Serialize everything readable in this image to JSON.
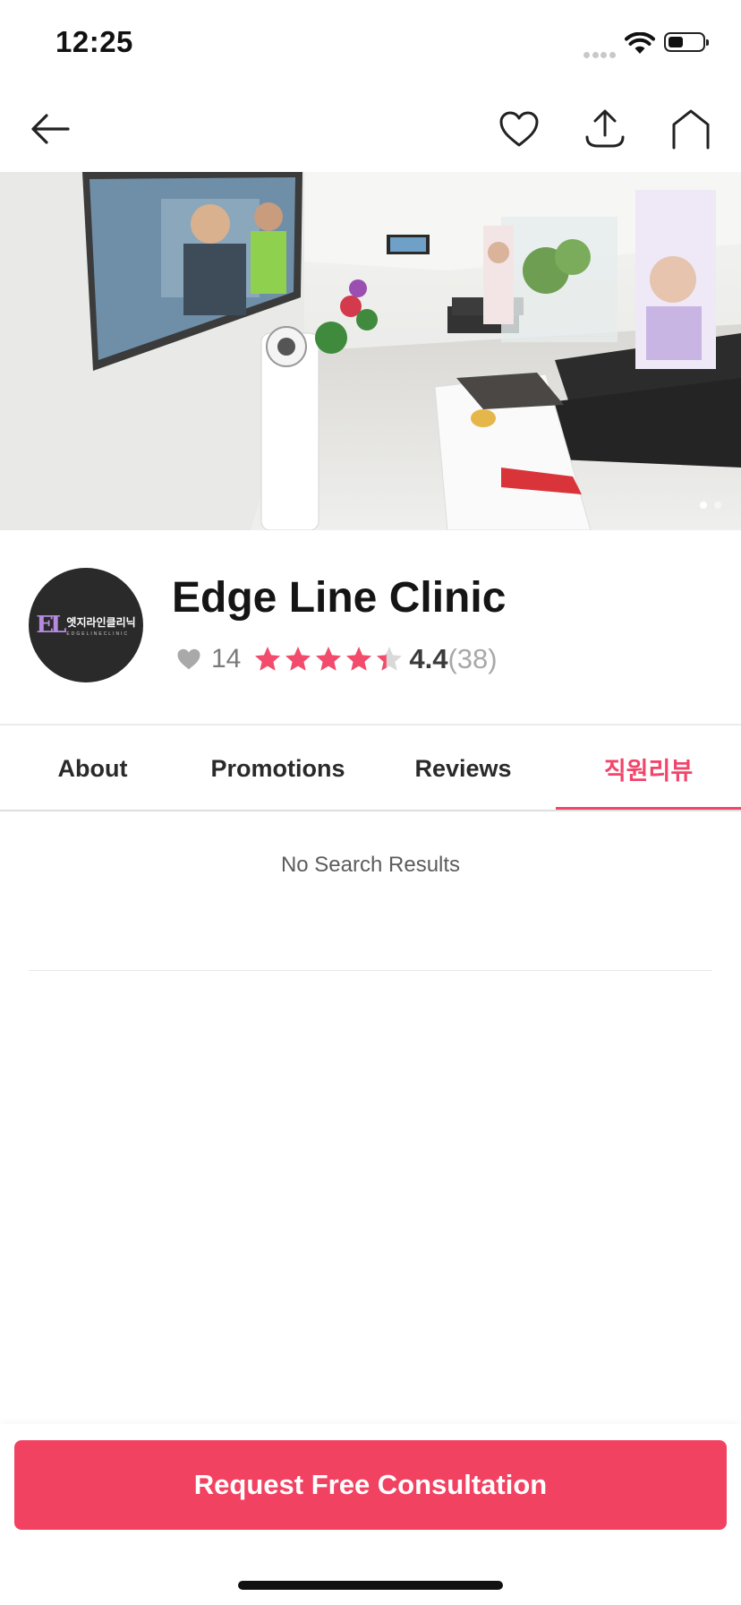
{
  "status_bar": {
    "time": "12:25"
  },
  "nav": {
    "icons": [
      "back-arrow-icon",
      "heart-outline-icon",
      "share-icon",
      "home-icon"
    ]
  },
  "hero": {
    "image_description_icon": "clinic-waiting-room-photo",
    "page_count": 2,
    "active_page": 1
  },
  "clinic": {
    "logo_text_ko": "엣지라인클리닉",
    "logo_text_en": "EDGELINECLINIC",
    "logo_mark": "EL",
    "name": "Edge Line Clinic",
    "likes": "14",
    "rating": "4.4",
    "rating_count": "(38)",
    "stars_filled": 4.4,
    "stars_max": 5
  },
  "tabs": [
    {
      "label": "About",
      "active": false
    },
    {
      "label": "Promotions",
      "active": false
    },
    {
      "label": "Reviews",
      "active": false
    },
    {
      "label": "직원리뷰",
      "active": true
    }
  ],
  "content": {
    "empty_text": "No Search Results"
  },
  "cta": {
    "label": "Request Free Consultation"
  },
  "colors": {
    "accent": "#f1456a",
    "cta": "#f24262",
    "star": "#f24b6b",
    "star_empty": "#d9d9d9"
  }
}
